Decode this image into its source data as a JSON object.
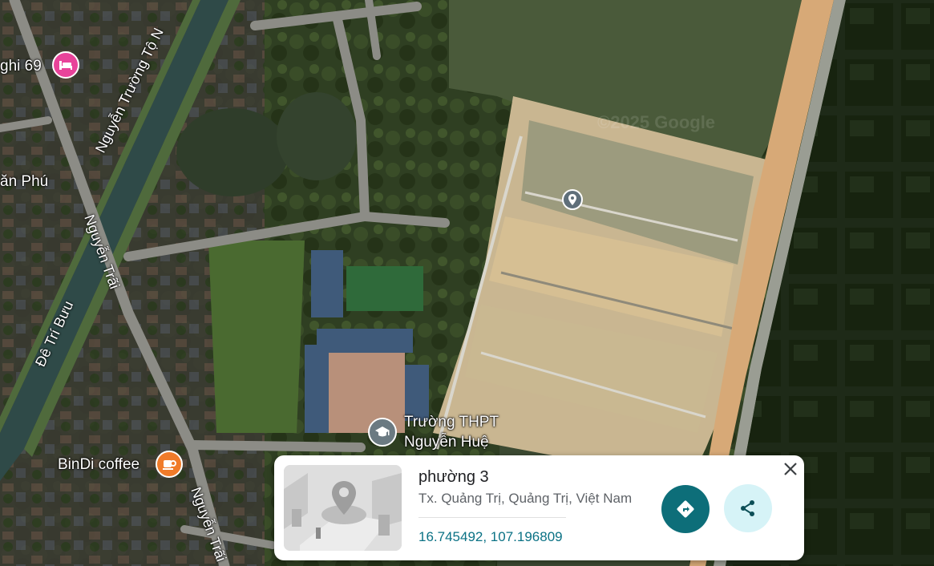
{
  "map": {
    "place_labels": {
      "guesthouse": "ghi 69",
      "coffee": "BinDi coffee",
      "school_line1": "Trường THPT",
      "school_line2": "Nguyễn Huệ",
      "area": "ăn Phú"
    },
    "road_labels": {
      "nguyen_truong_to": "Nguyễn Trường Tộ N",
      "nguyen_trai_upper": "Nguyễn Trãi",
      "nguyen_trai_lower": "Nguyễn Trãi",
      "de_tri_buu": "Đê Trí Bưu"
    },
    "watermark": "©2025 Google",
    "icons": {
      "guesthouse": "hotel-bed-icon",
      "coffee": "coffee-cup-icon",
      "school": "graduation-cap-icon",
      "marker": "location-pin-icon"
    },
    "colors": {
      "hotel_pin": "#e8439a",
      "coffee_pin": "#f07b2a",
      "school_pin": "#6b7a82"
    }
  },
  "card": {
    "title": "phường 3",
    "address": "Tx. Quảng Trị, Quảng Trị, Việt Nam",
    "coordinates": "16.745492, 107.196809",
    "icons": {
      "directions": "directions-arrow-icon",
      "share": "share-icon",
      "close": "close-icon"
    },
    "colors": {
      "directions_bg": "#0d6e79",
      "share_bg": "#d6f3f7",
      "coords_text": "#0b7285"
    }
  }
}
